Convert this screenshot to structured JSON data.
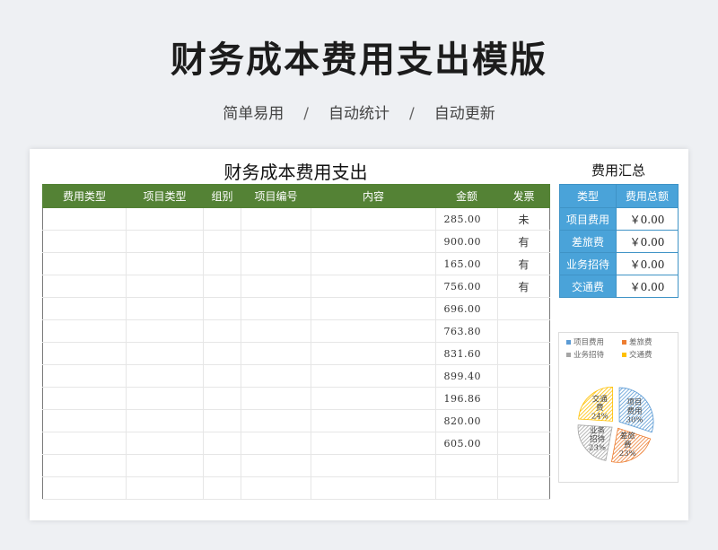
{
  "hero": {
    "title": "财务成本费用支出模版",
    "features": [
      "简单易用",
      "自动统计",
      "自动更新"
    ],
    "separator": "/"
  },
  "sheet": {
    "title": "财务成本费用支出",
    "columns": [
      "费用类型",
      "项目类型",
      "组别",
      "项目编号",
      "内容",
      "金额",
      "发票"
    ],
    "rows": [
      {
        "amount": "285.00",
        "invoice": "未"
      },
      {
        "amount": "900.00",
        "invoice": "有"
      },
      {
        "amount": "165.00",
        "invoice": "有"
      },
      {
        "amount": "756.00",
        "invoice": "有"
      },
      {
        "amount": "696.00",
        "invoice": ""
      },
      {
        "amount": "763.80",
        "invoice": ""
      },
      {
        "amount": "831.60",
        "invoice": ""
      },
      {
        "amount": "899.40",
        "invoice": ""
      },
      {
        "amount": "196.86",
        "invoice": ""
      },
      {
        "amount": "820.00",
        "invoice": ""
      },
      {
        "amount": "605.00",
        "invoice": ""
      },
      {
        "amount": "",
        "invoice": ""
      },
      {
        "amount": "",
        "invoice": ""
      }
    ]
  },
  "summary": {
    "title": "费用汇总",
    "headers": [
      "类型",
      "费用总额"
    ],
    "rows": [
      {
        "category": "项目费用",
        "total": "￥0.00"
      },
      {
        "category": "差旅费",
        "total": "￥0.00"
      },
      {
        "category": "业务招待",
        "total": "￥0.00"
      },
      {
        "category": "交通费",
        "total": "￥0.00"
      }
    ]
  },
  "chart_data": {
    "type": "pie",
    "legend_position": "top",
    "categories": [
      "项目费用",
      "差旅费",
      "业务招待",
      "交通费"
    ],
    "values": [
      30,
      23,
      23,
      24
    ],
    "slice_labels": [
      [
        "项目",
        "费用",
        "30%"
      ],
      [
        "差旅",
        "费",
        "23%"
      ],
      [
        "业务",
        "招待",
        "23%"
      ],
      [
        "交通",
        "费",
        "24%"
      ]
    ],
    "colors": [
      "#5b9bd5",
      "#ed7d31",
      "#a5a5a5",
      "#ffc000"
    ]
  },
  "colors": {
    "table_header": "#548235",
    "summary_header": "#4aa3d9"
  }
}
